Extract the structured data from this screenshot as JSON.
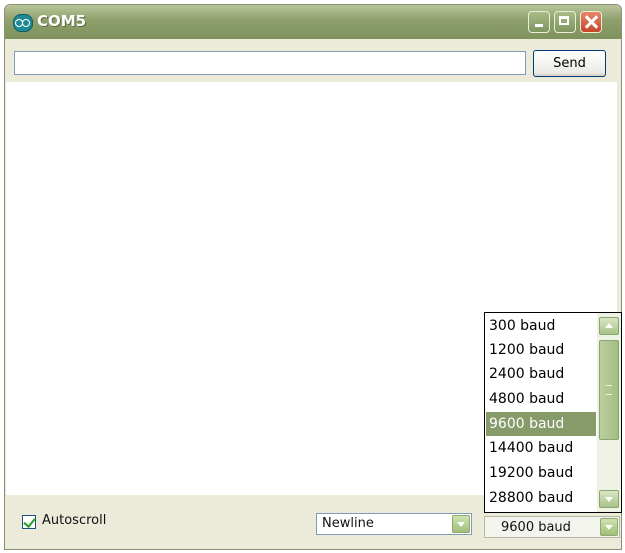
{
  "window": {
    "title": "COM5",
    "icon": "arduino-icon",
    "controls": {
      "minimize": "minimize-icon",
      "maximize": "maximize-icon",
      "close": "close-icon"
    }
  },
  "send": {
    "input_value": "",
    "button_label": "Send"
  },
  "bottom": {
    "autoscroll_label": "Autoscroll",
    "autoscroll_checked": true,
    "line_ending": "Newline",
    "baud_selected": "9600 baud"
  },
  "baud_list": {
    "items": [
      "300 baud",
      "1200 baud",
      "2400 baud",
      "4800 baud",
      "9600 baud",
      "14400 baud",
      "19200 baud",
      "28800 baud"
    ],
    "selected_index": 4
  },
  "colors": {
    "titlebar": "#8e9f6c",
    "selection": "#879a6a"
  }
}
